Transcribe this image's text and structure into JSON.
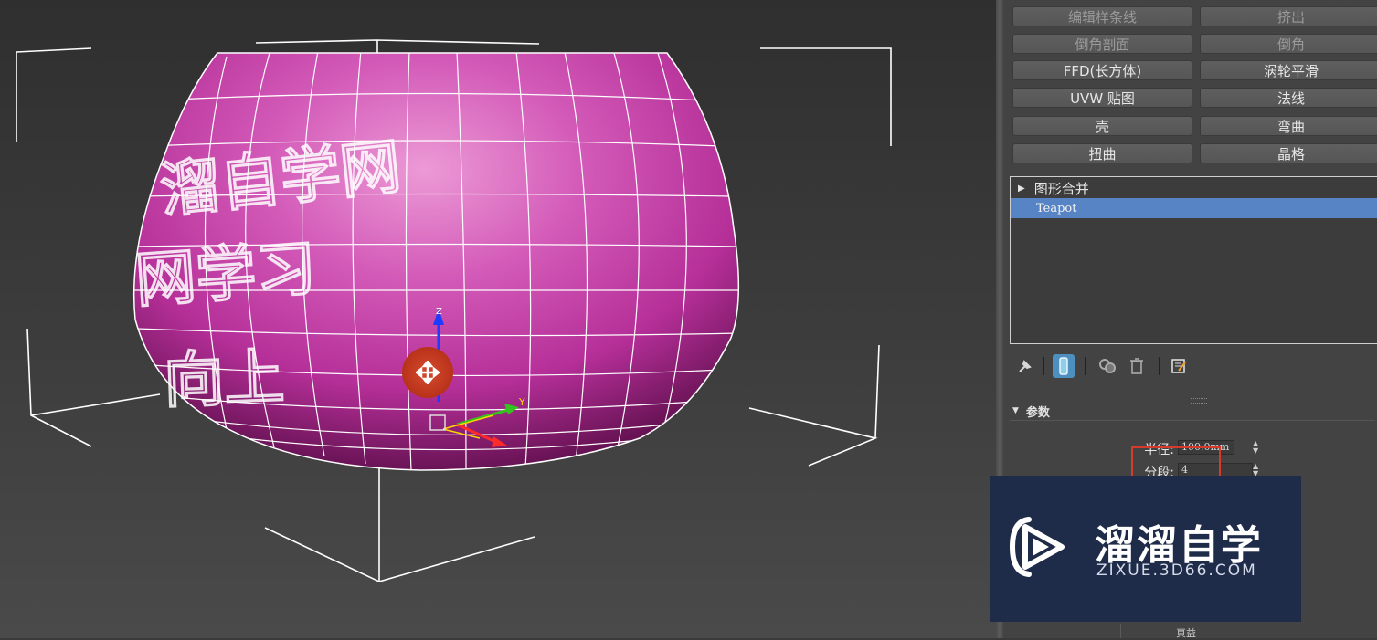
{
  "viewport": {
    "watermark_text_lines": [
      "溜自学网",
      "网学习",
      "向上"
    ],
    "gizmo_axes": {
      "z": "Z",
      "y": "Y"
    }
  },
  "modifier_buttons": [
    {
      "label": "编辑样条线",
      "enabled": false
    },
    {
      "label": "挤出",
      "enabled": false
    },
    {
      "label": "倒角剖面",
      "enabled": false
    },
    {
      "label": "倒角",
      "enabled": false
    },
    {
      "label": "FFD(长方体)",
      "enabled": true
    },
    {
      "label": "涡轮平滑",
      "enabled": true
    },
    {
      "label": "UVW 贴图",
      "enabled": true
    },
    {
      "label": "法线",
      "enabled": true
    },
    {
      "label": "壳",
      "enabled": true
    },
    {
      "label": "弯曲",
      "enabled": true
    },
    {
      "label": "扭曲",
      "enabled": true
    },
    {
      "label": "晶格",
      "enabled": true
    }
  ],
  "modifier_stack": {
    "items": [
      {
        "label": "图形合并",
        "expandable": true
      },
      {
        "label": "Teapot",
        "selected": true
      }
    ]
  },
  "stack_toolbar": {
    "icons": [
      "pin-stack-icon",
      "show-end-result-icon",
      "make-unique-icon",
      "remove-modifier-icon",
      "configure-modifier-sets-icon"
    ]
  },
  "parameters": {
    "rollout_title": "参数",
    "radius": {
      "label": "半径:",
      "value": "100.0mm"
    },
    "segments": {
      "label": "分段:",
      "value": "4"
    },
    "bottom_label": "真益"
  },
  "watermark": {
    "brand": "溜溜自学",
    "url": "ZIXUE.3D66.COM"
  },
  "colors": {
    "teapot": "#c2399f",
    "selection": "#5784c4",
    "highlight": "#d73a2a",
    "watermark_bg": "#1f2c49"
  }
}
